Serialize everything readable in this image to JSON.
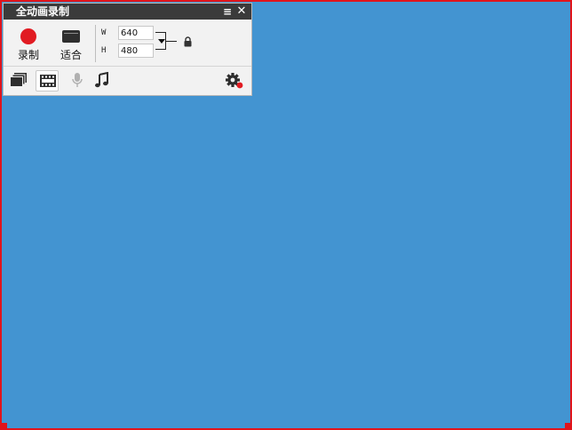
{
  "panel": {
    "title": "全动画录制",
    "menu_glyph": "≡",
    "close_glyph": "✕"
  },
  "toolbar": {
    "record_label": "录制",
    "fit_label": "适合",
    "width_label": "W",
    "height_label": "H",
    "width_value": "640",
    "height_value": "480"
  },
  "icons": {
    "record": "record-dot-icon",
    "fit": "window-fit-icon",
    "lock": "lock-icon",
    "windows": "multiple-windows-icon",
    "film": "film-strip-icon",
    "mic": "microphone-icon",
    "music": "music-note-icon",
    "settings": "gear-icon"
  },
  "colors": {
    "background": "#4394d1",
    "frame": "#e1141b",
    "titlebar": "#3b3b3b",
    "record": "#e11b22"
  }
}
